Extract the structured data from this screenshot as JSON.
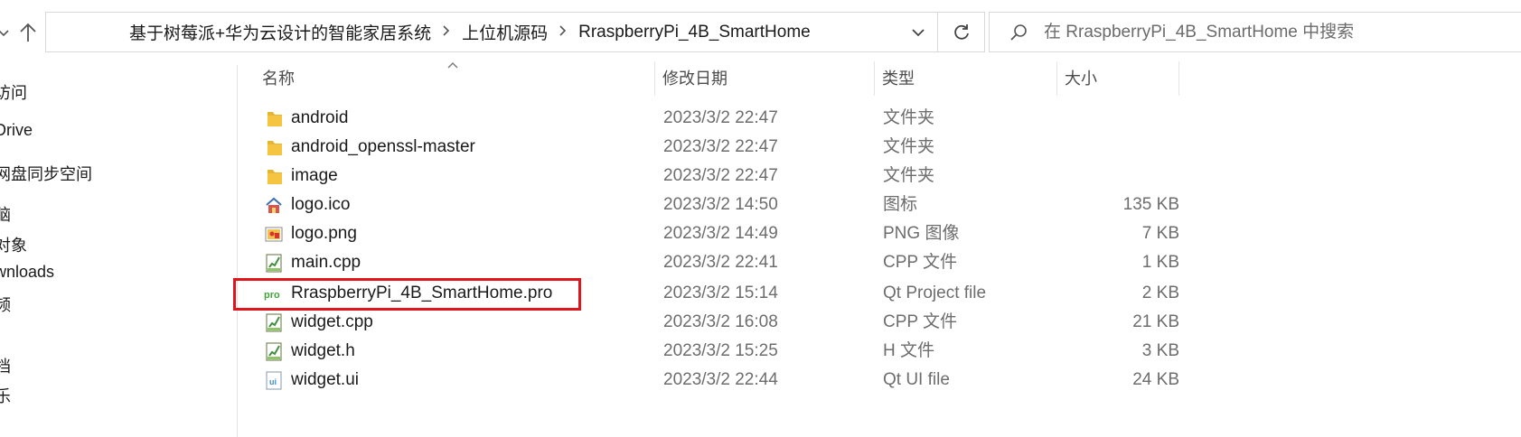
{
  "address_bar": {
    "breadcrumbs": [
      "基于树莓派+华为云设计的智能家居系统",
      "上位机源码",
      "RraspberryPi_4B_SmartHome"
    ],
    "separator": ">"
  },
  "search": {
    "placeholder": "在 RraspberryPi_4B_SmartHome 中搜索"
  },
  "sidebar": {
    "items": [
      "访问",
      "Drive",
      "网盘同步空间",
      "脑",
      "对象",
      "wnloads",
      "频",
      "}",
      "档",
      "乐"
    ]
  },
  "columns": {
    "name": "名称",
    "modified": "修改日期",
    "type": "类型",
    "size": "大小"
  },
  "files": [
    {
      "name": "android",
      "modified": "2023/3/2 22:47",
      "type": "文件夹",
      "size": "",
      "icon": "folder-icon"
    },
    {
      "name": "android_openssl-master",
      "modified": "2023/3/2 22:47",
      "type": "文件夹",
      "size": "",
      "icon": "folder-icon"
    },
    {
      "name": "image",
      "modified": "2023/3/2 22:47",
      "type": "文件夹",
      "size": "",
      "icon": "folder-icon"
    },
    {
      "name": "logo.ico",
      "modified": "2023/3/2 14:50",
      "type": "图标",
      "size": "135 KB",
      "icon": "ico-file-icon"
    },
    {
      "name": "logo.png",
      "modified": "2023/3/2 14:49",
      "type": "PNG 图像",
      "size": "7 KB",
      "icon": "png-file-icon"
    },
    {
      "name": "main.cpp",
      "modified": "2023/3/2 22:41",
      "type": "CPP 文件",
      "size": "1 KB",
      "icon": "cpp-file-icon"
    },
    {
      "name": "RraspberryPi_4B_SmartHome.pro",
      "modified": "2023/3/2 15:14",
      "type": "Qt Project file",
      "size": "2 KB",
      "icon": "qt-pro-file-icon"
    },
    {
      "name": "widget.cpp",
      "modified": "2023/3/2 16:08",
      "type": "CPP 文件",
      "size": "21 KB",
      "icon": "cpp-file-icon"
    },
    {
      "name": "widget.h",
      "modified": "2023/3/2 15:25",
      "type": "H 文件",
      "size": "3 KB",
      "icon": "h-file-icon"
    },
    {
      "name": "widget.ui",
      "modified": "2023/3/2 22:44",
      "type": "Qt UI file",
      "size": "24 KB",
      "icon": "ui-file-icon"
    }
  ],
  "pro_icon_text": "pro",
  "ui_icon_text": "ui",
  "colors": {
    "highlight": "#e0151b",
    "folder": "#f5c542",
    "accent": "#3b8fd8"
  }
}
